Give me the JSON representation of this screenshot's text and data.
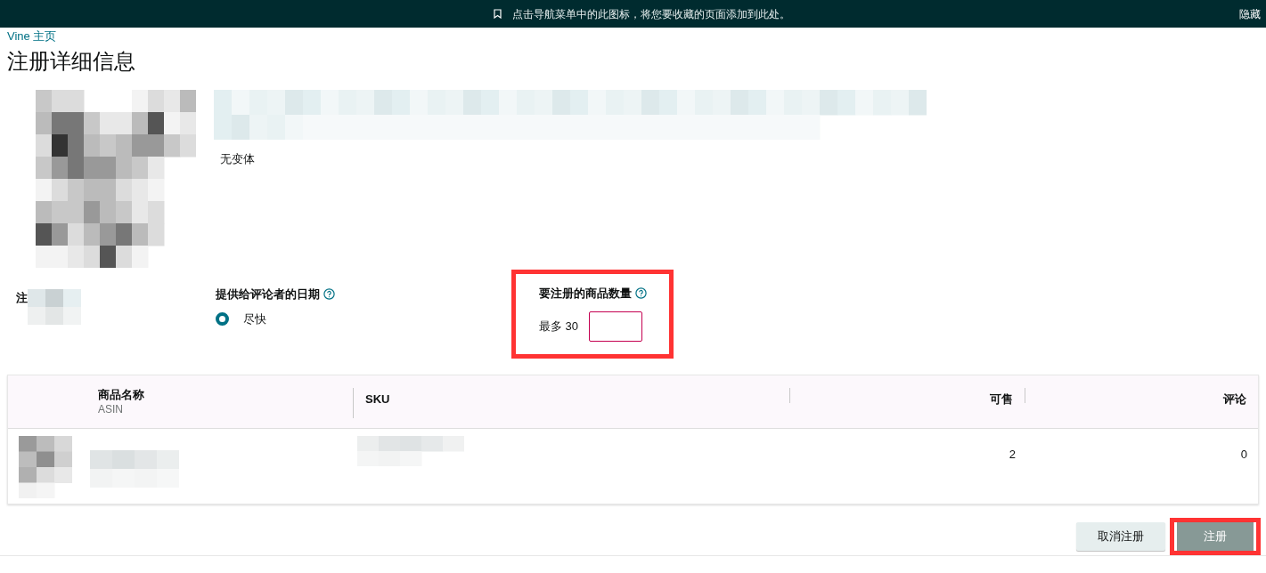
{
  "banner": {
    "message": "点击导航菜单中的此图标，将您要收藏的页面添加到此处。",
    "hide": "隐藏"
  },
  "breadcrumb": "Vine 主页",
  "title": "注册详细信息",
  "product": {
    "variation": "无变体"
  },
  "registration": {
    "label": "注"
  },
  "delivery_date": {
    "label": "提供给评论者的日期",
    "options": [
      {
        "label": "尽快",
        "selected": true
      }
    ]
  },
  "quantity": {
    "label": "要注册的商品数量",
    "limit": "最多 30",
    "highlighted": true
  },
  "table": {
    "columns": [
      {
        "title": "商品名称",
        "subtitle": "ASIN"
      },
      {
        "title": "SKU"
      },
      {
        "title": "可售"
      },
      {
        "title": "评论"
      }
    ],
    "rows": [
      {
        "available": "2",
        "reviews": "0"
      }
    ]
  },
  "buttons": [
    {
      "label": "取消注册",
      "kind": "secondary",
      "highlighted": false
    },
    {
      "label": "注册",
      "kind": "primary",
      "highlighted": true
    }
  ]
}
